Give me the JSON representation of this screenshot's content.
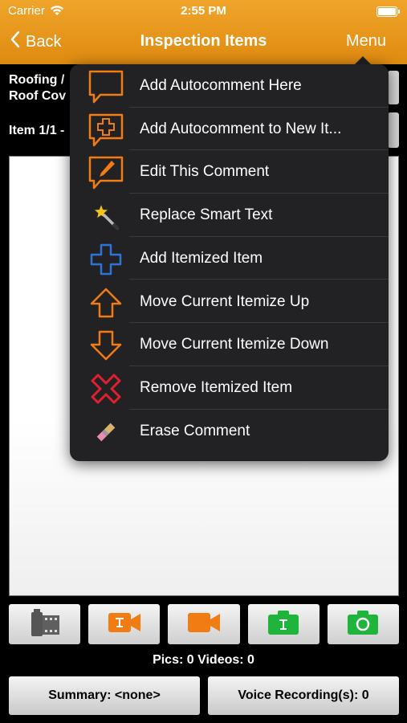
{
  "status_bar": {
    "carrier": "Carrier",
    "time": "2:55 PM"
  },
  "nav": {
    "back_label": "Back",
    "title": "Inspection Items",
    "menu_label": "Menu"
  },
  "section": {
    "line1": "Roofing /",
    "line2": "Roof Cov",
    "item_counter": "Item 1/1 -"
  },
  "menu": {
    "items": [
      {
        "label": "Add Autocomment Here",
        "icon": "speech-bubble-icon"
      },
      {
        "label": "Add Autocomment to New It...",
        "icon": "speech-bubble-plus-icon"
      },
      {
        "label": "Edit This Comment",
        "icon": "speech-bubble-pencil-icon"
      },
      {
        "label": "Replace Smart Text",
        "icon": "magic-wand-icon"
      },
      {
        "label": "Add Itemized Item",
        "icon": "plus-icon"
      },
      {
        "label": "Move Current Itemize Up",
        "icon": "arrow-up-icon"
      },
      {
        "label": "Move Current Itemize Down",
        "icon": "arrow-down-icon"
      },
      {
        "label": "Remove Itemized Item",
        "icon": "red-x-icon"
      },
      {
        "label": "Erase Comment",
        "icon": "eraser-icon"
      }
    ]
  },
  "media": {
    "buttons": [
      {
        "name": "film-roll-icon"
      },
      {
        "name": "orange-text-video-icon"
      },
      {
        "name": "orange-video-camera-icon"
      },
      {
        "name": "green-text-camera-icon"
      },
      {
        "name": "green-camera-icon"
      }
    ],
    "counts_label": "Pics: 0 Videos: 0"
  },
  "bottom": {
    "summary_label": "Summary: <none>",
    "voice_label": "Voice Recording(s): 0"
  },
  "colors": {
    "accent": "#e8961c",
    "green": "#1fb53c",
    "orange": "#f07c13",
    "blue": "#2e73d8",
    "red": "#e0202c",
    "popup_bg": "#222224"
  }
}
